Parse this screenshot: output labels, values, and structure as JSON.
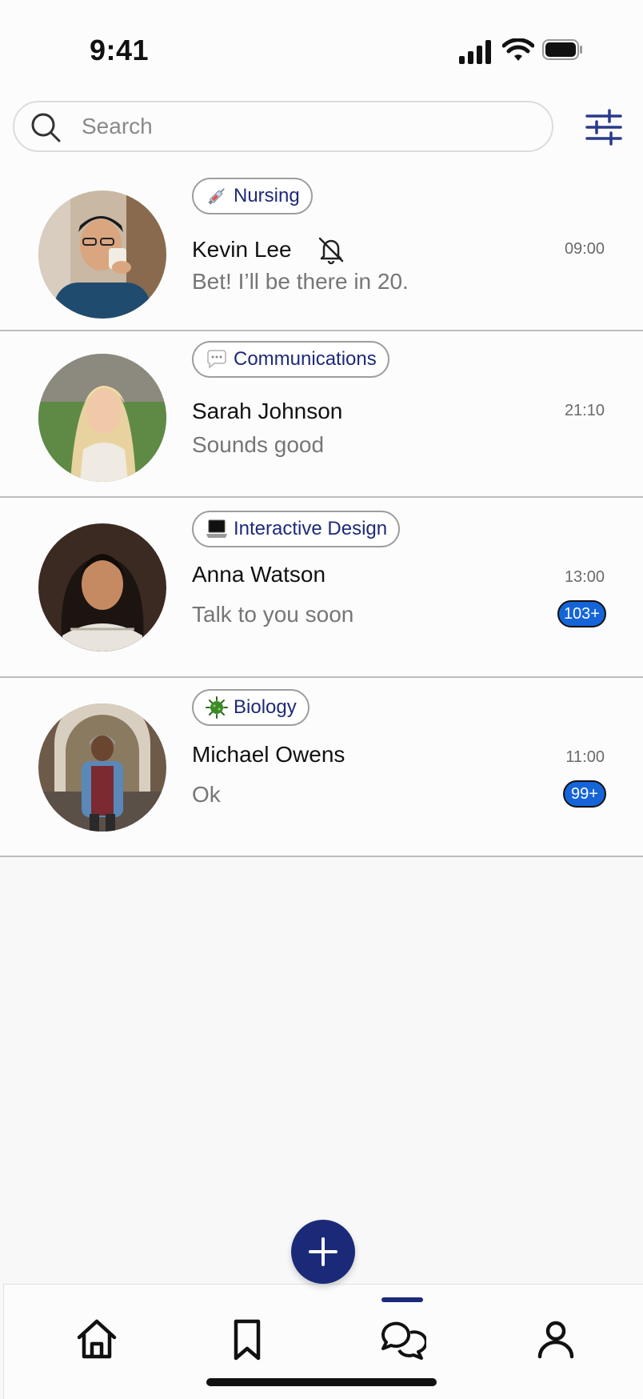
{
  "status_bar": {
    "time": "9:41"
  },
  "search": {
    "placeholder": "Search",
    "value": ""
  },
  "colors": {
    "accent": "#1b2a78",
    "tag_text": "#1e2a78",
    "badge": "#1565d8"
  },
  "chats": [
    {
      "tag": "Nursing",
      "tag_icon": "syringe-icon",
      "name": "Kevin Lee",
      "preview": "Bet! I’ll be there in  20.",
      "time": "09:00",
      "muted": true,
      "unread": ""
    },
    {
      "tag": "Communications",
      "tag_icon": "speech-bubble-icon",
      "name": "Sarah Johnson",
      "preview": "Sounds good",
      "time": "21:10",
      "muted": false,
      "unread": ""
    },
    {
      "tag": "Interactive Design",
      "tag_icon": "laptop-icon",
      "name": "Anna Watson",
      "preview": "Talk to you soon",
      "time": "13:00",
      "muted": false,
      "unread": "103+"
    },
    {
      "tag": "Biology",
      "tag_icon": "microbe-icon",
      "name": "Michael Owens",
      "preview": "Ok",
      "time": "11:00",
      "muted": false,
      "unread": "99+"
    }
  ],
  "bottom_nav": {
    "items": [
      {
        "name": "home",
        "icon": "home-icon",
        "active": false
      },
      {
        "name": "saved",
        "icon": "bookmark-icon",
        "active": false
      },
      {
        "name": "messages",
        "icon": "chat-bubbles-icon",
        "active": true
      },
      {
        "name": "profile",
        "icon": "person-icon",
        "active": false
      }
    ]
  },
  "fab": {
    "icon": "plus-icon"
  }
}
